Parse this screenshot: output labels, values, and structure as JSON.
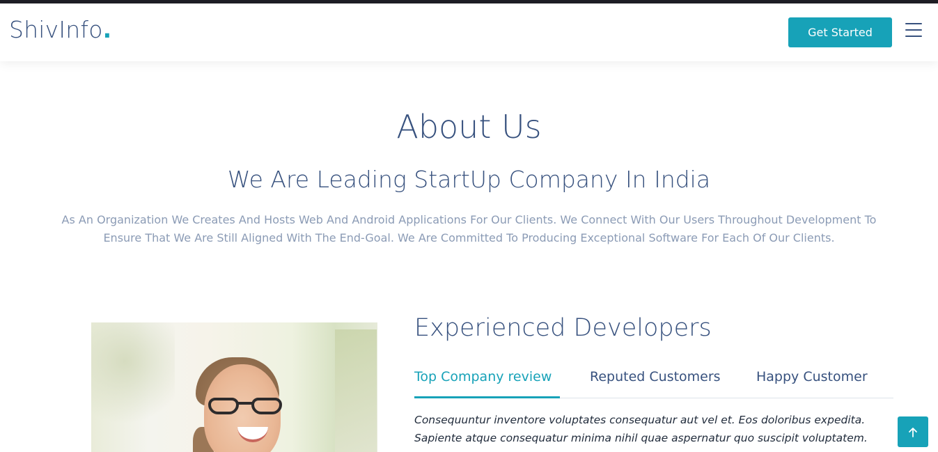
{
  "header": {
    "logo_text": "ShivInfo",
    "logo_dot": ".",
    "cta_label": "Get Started",
    "menu_icon": "hamburger-icon"
  },
  "about": {
    "title": "About Us",
    "subtitle": "We Are Leading StartUp Company In India",
    "description": "As An Organization We Creates And Hosts Web And Android Applications For Our Clients. We Connect With Our Users Throughout Development To Ensure That We Are Still Aligned With The End-Goal. We Are Committed To Producing Exceptional Software For Each Of Our Clients."
  },
  "features": {
    "title": "Experienced Developers",
    "tabs": [
      {
        "label": "Top Company review",
        "active": true
      },
      {
        "label": "Reputed Customers",
        "active": false
      },
      {
        "label": "Happy Customer",
        "active": false
      }
    ],
    "content": "Consequuntur inventore voluptates consequatur aut vel et. Eos doloribus expedita. Sapiente atque consequatur minima nihil quae aspernatur quo suscipit voluptatem."
  },
  "back_to_top_icon": "arrow-up-icon",
  "colors": {
    "accent": "#17a2b8",
    "heading": "#37517e",
    "muted_text": "#8b9bb5"
  }
}
